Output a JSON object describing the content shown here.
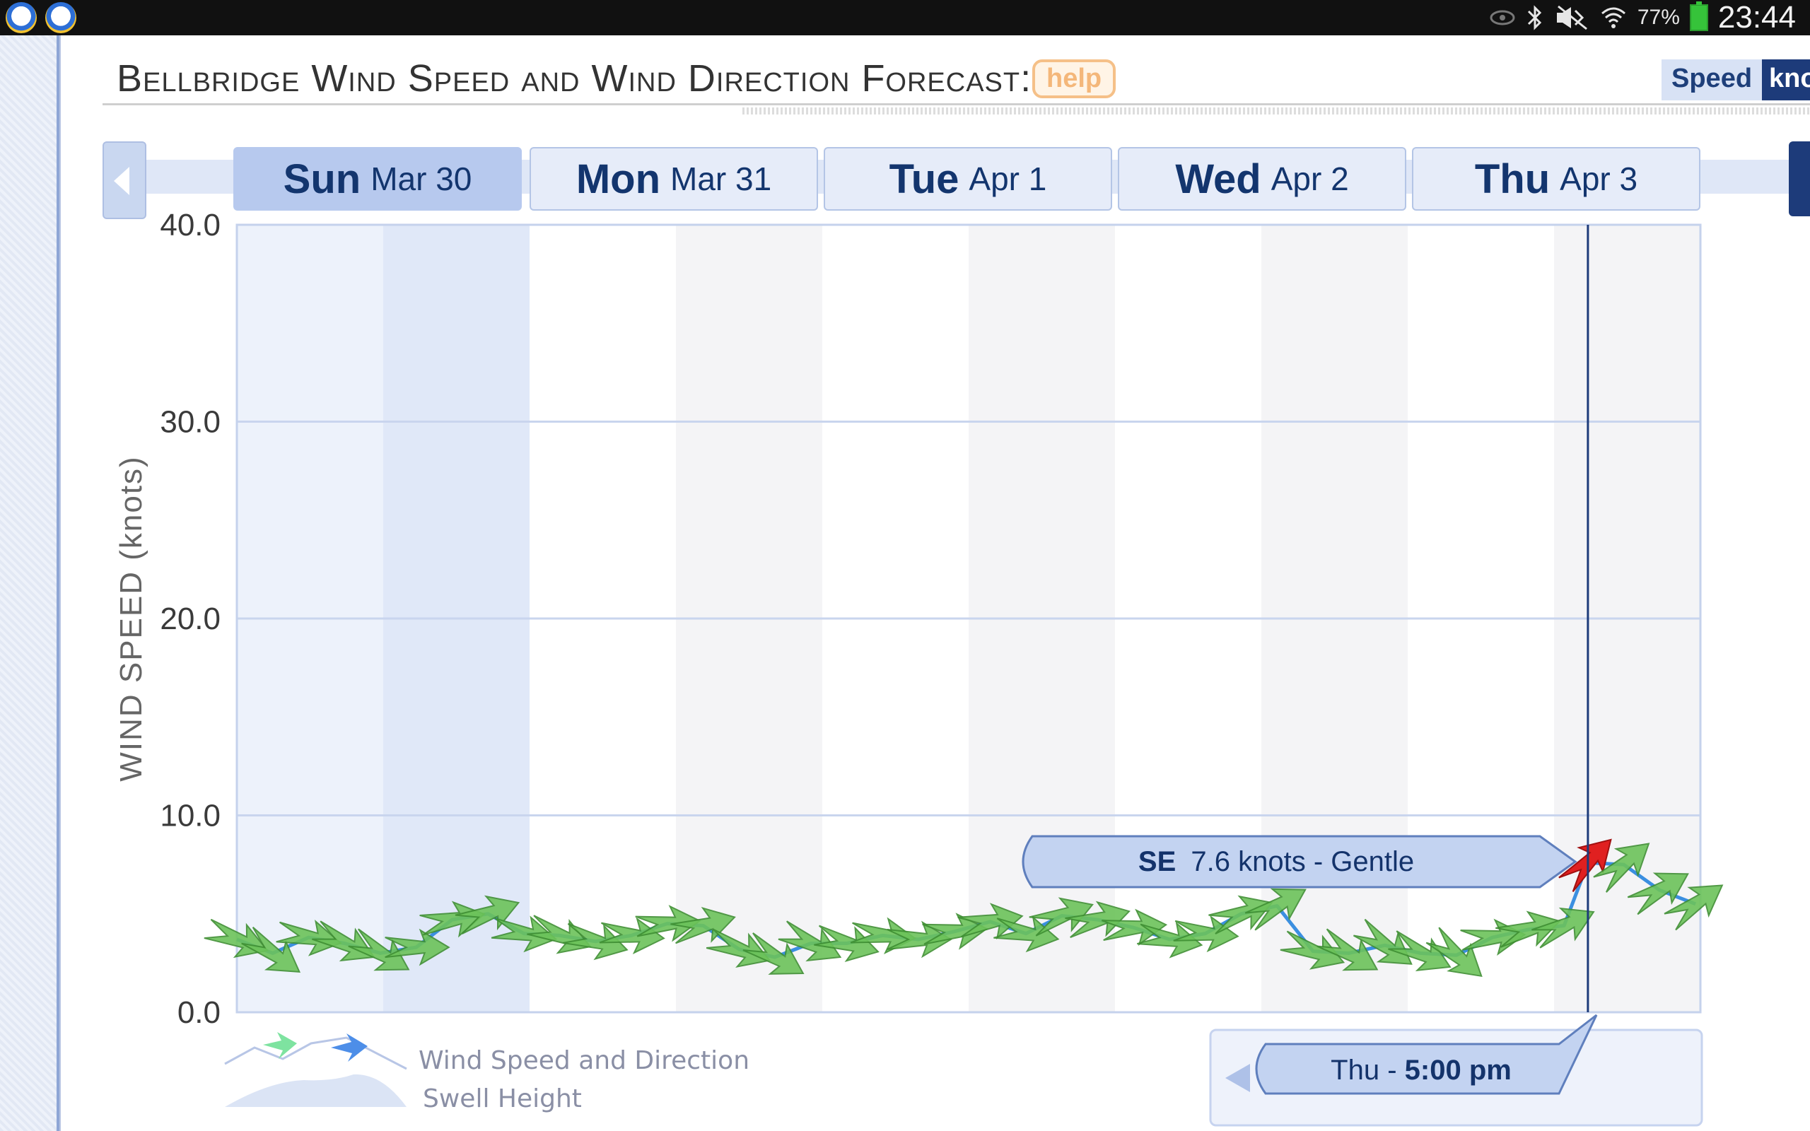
{
  "status_bar": {
    "battery_percent": "77%",
    "time": "23:44",
    "icons": [
      "eye-icon",
      "bluetooth-icon",
      "mute-icon",
      "signal-icon",
      "wifi-icon",
      "battery-icon"
    ]
  },
  "header": {
    "title": "Bellbridge Wind Speed and Wind Direction Forecast:",
    "help_label": "help",
    "speed_label": "Speed",
    "unit_label": "knots"
  },
  "days": [
    {
      "name": "Sun",
      "date": "Mar 30",
      "active": true
    },
    {
      "name": "Mon",
      "date": "Mar 31",
      "active": false
    },
    {
      "name": "Tue",
      "date": "Apr 1",
      "active": false
    },
    {
      "name": "Wed",
      "date": "Apr 2",
      "active": false
    },
    {
      "name": "Thu",
      "date": "Apr 3",
      "active": false
    }
  ],
  "tooltip": {
    "direction": "SE",
    "value_text": "7.6 knots - Gentle"
  },
  "time_marker": {
    "day": "Thu - ",
    "time": "5:00 pm"
  },
  "legend": {
    "wind": "Wind Speed and Direction",
    "swell": "Swell Height"
  },
  "colors": {
    "line": "#3b8fe0",
    "arrow_fill": "#6cc35a",
    "arrow_edge": "#3f8f33",
    "highlight_arrow": "#e02020",
    "accent_dark": "#1d3b7a"
  },
  "chart_data": {
    "type": "line",
    "ylabel": "WIND SPEED (knots)",
    "ylim": [
      0,
      40
    ],
    "yticks": [
      "0.0",
      "10.0",
      "20.0",
      "30.0",
      "40.0"
    ],
    "x_unit": "days from Sun Mar 30 00:00",
    "xlim": [
      0,
      5.1
    ],
    "grid": true,
    "series": [
      {
        "name": "Wind Speed and Direction",
        "x": [
          0,
          0.125,
          0.25,
          0.375,
          0.5,
          0.625,
          0.75,
          0.875,
          1,
          1.125,
          1.25,
          1.375,
          1.5,
          1.625,
          1.75,
          1.875,
          2,
          2.125,
          2.25,
          2.375,
          2.5,
          2.625,
          2.75,
          2.875,
          3,
          3.125,
          3.25,
          3.375,
          3.5,
          3.625,
          3.75,
          3.875,
          4,
          4.125,
          4.25,
          4.375,
          4.5,
          4.625,
          4.708,
          4.833,
          4.958,
          5.083
        ],
        "y": [
          3.7,
          3.0,
          3.8,
          3.5,
          3.0,
          3.3,
          4.7,
          5.0,
          4.0,
          3.9,
          3.6,
          3.9,
          4.5,
          4.4,
          3.2,
          2.8,
          3.5,
          3.5,
          3.9,
          3.7,
          4.1,
          4.6,
          4.0,
          4.9,
          4.7,
          4.3,
          3.7,
          4.0,
          5.0,
          5.4,
          3.1,
          3.0,
          3.4,
          3.0,
          2.9,
          3.8,
          4.2,
          4.4,
          7.6,
          7.5,
          6.2,
          5.5
        ],
        "directions_deg": [
          200,
          215,
          190,
          205,
          210,
          180,
          170,
          160,
          190,
          200,
          195,
          185,
          175,
          165,
          200,
          210,
          205,
          195,
          185,
          180,
          175,
          170,
          190,
          160,
          165,
          175,
          190,
          185,
          160,
          150,
          200,
          210,
          215,
          205,
          220,
          175,
          165,
          155,
          135,
          140,
          150,
          145
        ]
      }
    ],
    "highlight": {
      "x": 4.708,
      "y": 7.6
    }
  }
}
